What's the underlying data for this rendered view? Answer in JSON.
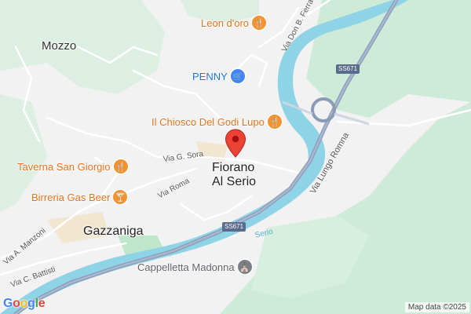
{
  "map": {
    "places": {
      "mozzo": "Mozzo",
      "fiorano": "Fiorano\nAl Serio",
      "gazzaniga": "Gazzaniga"
    },
    "pois": {
      "leon_doro": {
        "label": "Leon d'oro",
        "icon": "restaurant-icon"
      },
      "penny": {
        "label": "PENNY",
        "icon": "shopping-cart-icon"
      },
      "chiosco": {
        "label": "Il Chiosco Del Godi Lupo",
        "icon": "restaurant-icon"
      },
      "taverna": {
        "label": "Taverna San Giorgio",
        "icon": "restaurant-icon"
      },
      "birreria": {
        "label": "Birreria Gas Beer",
        "icon": "bar-icon"
      },
      "cappelletta": {
        "label": "Cappelletta Madonna",
        "icon": "place-of-worship-icon"
      }
    },
    "streets": {
      "don_ferra": "Via Don B. Ferra",
      "g_sora": "Via G. Sora",
      "roma": "Via Roma",
      "lungo_romna": "Via Lungo Romna",
      "manzoni": "Via A. Manzoni",
      "battisti": "Via C. Battisti"
    },
    "road_shields": {
      "ss671_top": "SS671",
      "ss671_bottom": "SS671"
    },
    "water": {
      "serio": "Serio"
    },
    "logo": "Google",
    "attribution": "Map data ©2025",
    "colors": {
      "land": "#f2f2f2",
      "green": "#c9ecd7",
      "river": "#8fd3e6",
      "highway": "#8a9bb8",
      "poi_orange": "#f29230",
      "poi_blue": "#4285f4",
      "pin_red": "#ea4335"
    }
  }
}
